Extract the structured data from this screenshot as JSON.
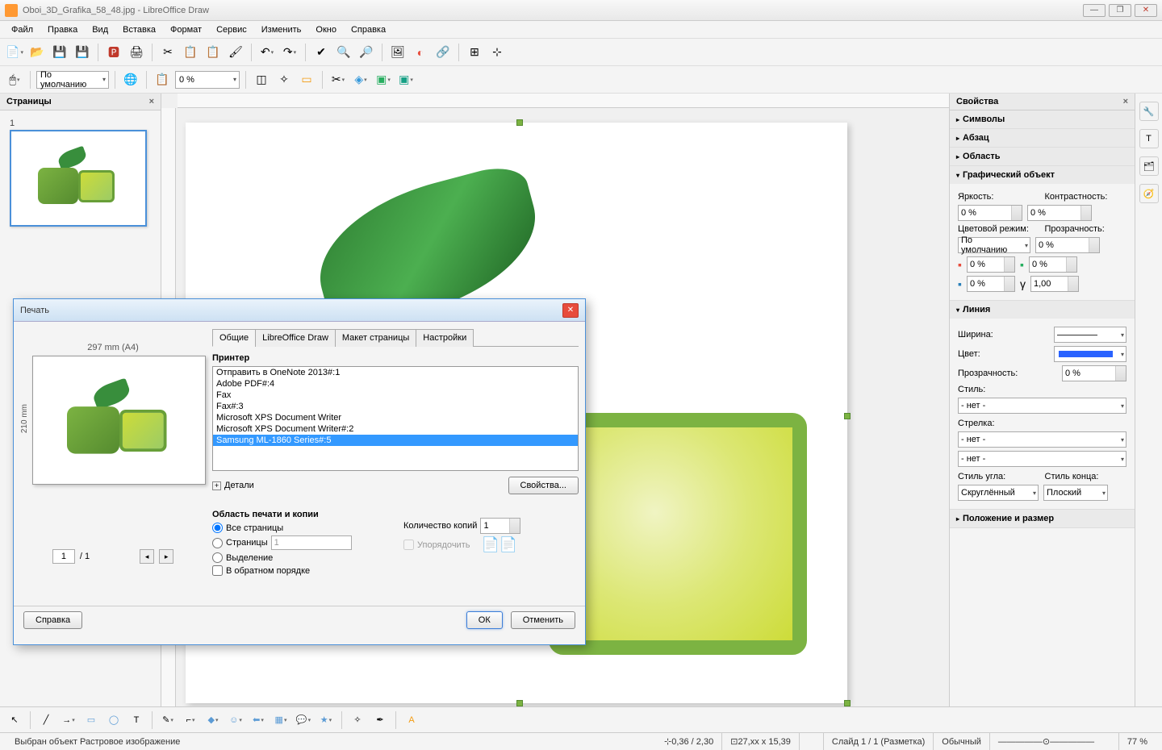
{
  "window": {
    "title": "Oboi_3D_Grafika_58_48.jpg - LibreOffice Draw"
  },
  "menu": [
    "Файл",
    "Правка",
    "Вид",
    "Вставка",
    "Формат",
    "Сервис",
    "Изменить",
    "Окно",
    "Справка"
  ],
  "toolbar2": {
    "style_combo": "По умолчанию",
    "zoom_combo": "0 %"
  },
  "pages": {
    "title": "Страницы",
    "thumb_num": "1"
  },
  "props": {
    "title": "Свойства",
    "sections": {
      "symbols": "Символы",
      "para": "Абзац",
      "area": "Область",
      "graphic": "Графический объект",
      "line": "Линия",
      "pos": "Положение и размер"
    },
    "brightness": "Яркость:",
    "contrast": "Контрастность:",
    "val0": "0 %",
    "colormode": "Цветовой режим:",
    "transparency": "Прозрачность:",
    "default": "По умолчанию",
    "gamma": "1,00",
    "width": "Ширина:",
    "color": "Цвет:",
    "transp2": "Прозрачность:",
    "transp2_val": "0 %",
    "style": "Стиль:",
    "arrow": "Стрелка:",
    "none": "- нет -",
    "corner": "Стиль угла:",
    "corner_val": "Скруглённый",
    "cap": "Стиль конца:",
    "cap_val": "Плоский"
  },
  "dialog": {
    "title": "Печать",
    "tabs": [
      "Общие",
      "LibreOffice Draw",
      "Макет страницы",
      "Настройки"
    ],
    "printer_label": "Принтер",
    "printers": [
      "Отправить в OneNote 2013#:1",
      "Adobe PDF#:4",
      "Fax",
      "Fax#:3",
      "Microsoft XPS Document Writer",
      "Microsoft XPS Document Writer#:2",
      "Samsung ML-1860 Series#:5"
    ],
    "selected_printer_index": 6,
    "details": "Детали",
    "props_btn": "Свойства...",
    "range_label": "Область печати и копии",
    "all_pages": "Все страницы",
    "pages_r": "Страницы",
    "pages_val": "1",
    "selection": "Выделение",
    "reverse": "В обратном порядке",
    "copies": "Количество копий",
    "copies_val": "1",
    "collate": "Упорядочить",
    "preview_w": "297 mm (A4)",
    "preview_h": "210 mm",
    "page_current": "1",
    "page_total": "/ 1",
    "help": "Справка",
    "ok": "ОК",
    "cancel": "Отменить"
  },
  "status": {
    "selection": "Выбран объект Растровое изображение",
    "pos": "0,36 / 2,30",
    "size": "27,xx x 15,39",
    "slide": "Слайд 1 / 1 (Разметка)",
    "mode": "Обычный",
    "zoom": "77 %"
  }
}
